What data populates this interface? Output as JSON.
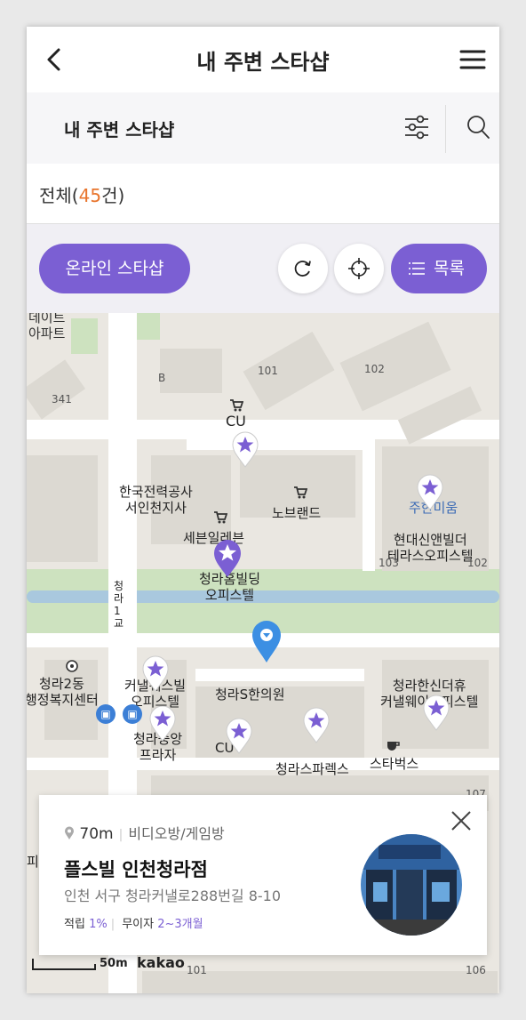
{
  "header": {
    "title": "내 주변 스타샵",
    "back_icon": "back-arrow-icon",
    "menu_icon": "hamburger-icon"
  },
  "subheader": {
    "title": "내 주변 스타샵",
    "filter_icon": "filter-sliders-icon",
    "search_icon": "search-icon"
  },
  "count": {
    "prefix": "전체(",
    "number": "45",
    "suffix": "건)"
  },
  "controls": {
    "online_label": "온라인 스타샵",
    "refresh_icon": "refresh-icon",
    "locate_icon": "crosshair-icon",
    "list_label": "목록",
    "list_icon": "list-icon"
  },
  "map": {
    "labels": {
      "apt_top": "데이트\n아파트",
      "b341": "341",
      "bB": "B",
      "b101a": "101",
      "b102": "102",
      "cu1": "CU",
      "kepco": "한국전력공사\n서인천지사",
      "nobrand": "노브랜드",
      "seven": "세븐일레븐",
      "hyundai": "현대신앤빌더\n테라스오피스텔",
      "juhan": "주한미움",
      "b103": "103",
      "b102b": "102",
      "chungra_bldg": "청라홈빌딩\n오피스텔",
      "bridge": "청라1교",
      "dong_office": "청라2동\n행정복지센터",
      "canal": "커낼웨스빌\n오피스텔",
      "hanuiwon": "청라S한의원",
      "central": "청라중앙\n프라자",
      "cu2": "CU",
      "shinhan": "청라한신더휴\n커낼웨이오피스텔",
      "parkx": "청라스파렉스",
      "starbucks": "스타벅스",
      "b107": "107",
      "b101b": "101",
      "b106": "106",
      "left_pi": "피"
    },
    "marker_icon": "star-marker-icon",
    "location_icon": "current-location-marker-icon",
    "bus_icon": "bus-stop-icon",
    "shop_icon": "cart-icon",
    "cafe_icon": "cafe-icon",
    "colors": {
      "accent": "#7b5fd3",
      "location": "#3c8fe3",
      "water": "#a9c8de",
      "green": "#cde2bf",
      "land": "#eae7e1",
      "building": "#dcd9d2"
    }
  },
  "card": {
    "distance": "70m",
    "category": "비디오방/게임방",
    "name": "플스빌 인천청라점",
    "address": "인천 서구 청라커낼로288번길 8-10",
    "points_label": "적립",
    "points_value": "1%",
    "interest_label": "무이자",
    "interest_value": "2~3개월",
    "close_icon": "close-icon",
    "pin_icon": "pin-icon",
    "thumb_icon": "store-photo-image"
  },
  "scale": {
    "label": "50m",
    "brand": "kakao"
  }
}
